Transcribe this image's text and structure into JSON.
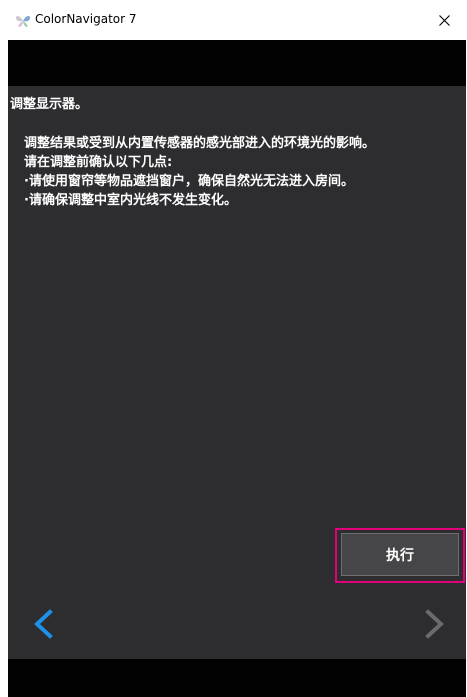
{
  "window": {
    "title": "ColorNavigator 7",
    "close_icon": "close-icon",
    "app_icon": "colornavigator-butterfly-icon"
  },
  "page": {
    "heading": "调整显示器。",
    "message_lines": [
      "调整结果或受到从内置传感器的感光部进入的环境光的影响。",
      "请在调整前确认以下几点:",
      "·请使用窗帘等物品遮挡窗户，确保自然光无法进入房间。",
      "·请确保调整中室内光线不发生变化。"
    ]
  },
  "actions": {
    "execute_label": "执行"
  },
  "navigation": {
    "prev_icon": "chevron-left-icon",
    "next_icon": "chevron-right-icon",
    "prev_enabled": true,
    "next_enabled": false
  },
  "colors": {
    "content_bg": "#2d2d30",
    "band_bg": "#020202",
    "accent_blue": "#1e90e8",
    "disabled_gray": "#6a6a6e",
    "highlight_magenta": "#e2007a"
  }
}
